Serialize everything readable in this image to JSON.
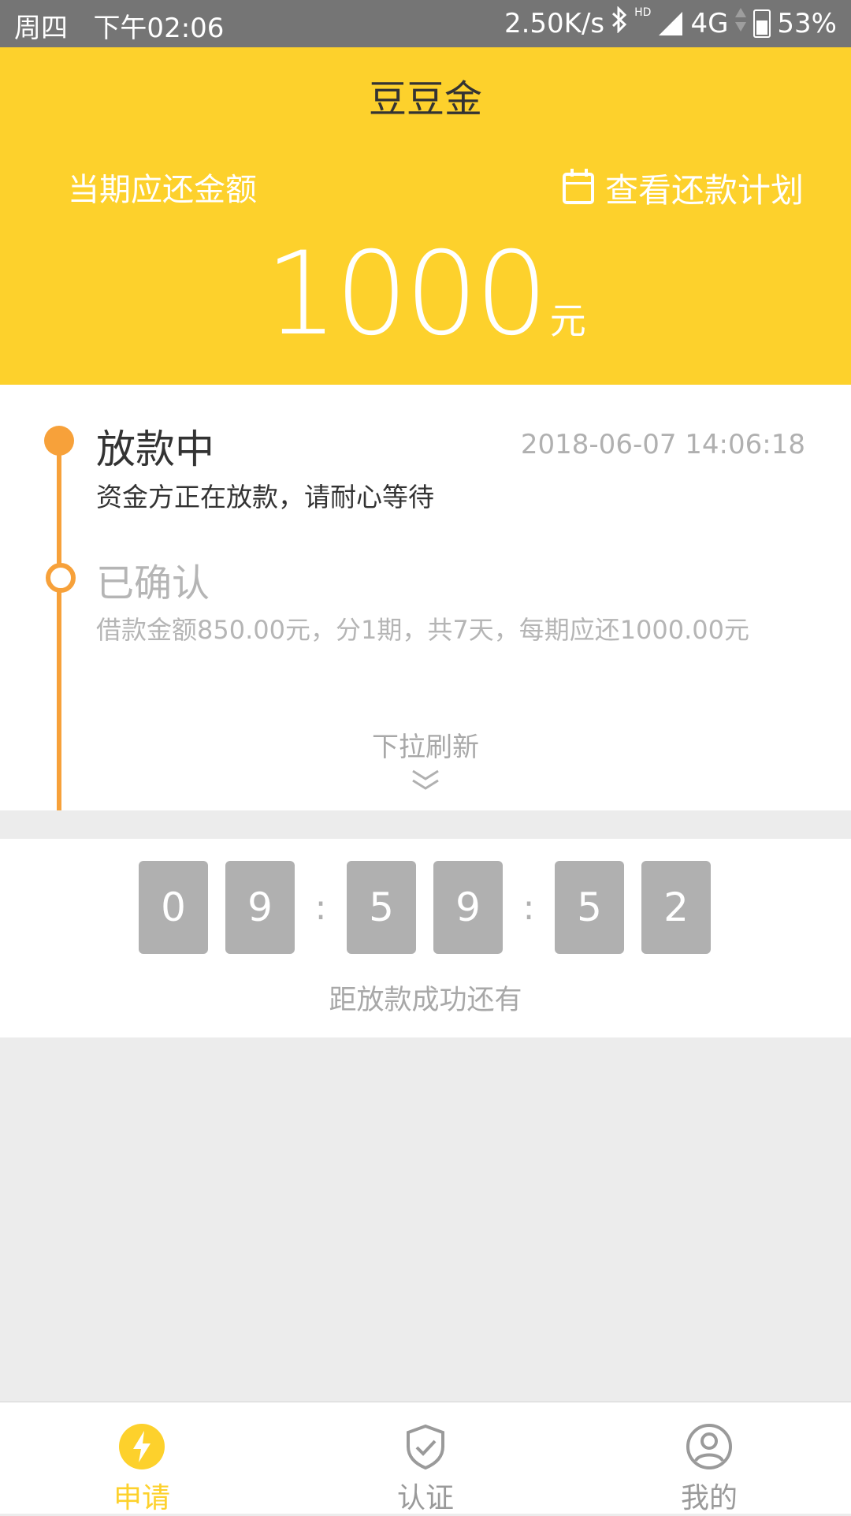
{
  "status_bar": {
    "day": "周四",
    "time": "下午02:06",
    "network_speed": "2.50K/s",
    "hd": "HD",
    "network_type": "4G",
    "battery": "53%"
  },
  "header": {
    "app_title": "豆豆金",
    "due_label": "当期应还金额",
    "plan_link_label": "查看还款计划",
    "amount": "1000",
    "amount_unit": "元",
    "background_color": "#fdd12c"
  },
  "timeline": {
    "accent_color": "#f7a13a",
    "events": [
      {
        "title": "放款中",
        "time": "2018-06-07 14:06:18",
        "description": "资金方正在放款，请耐心等待"
      },
      {
        "title": "已确认",
        "description": "借款金额850.00元，分1期，共7天，每期应还1000.00元"
      }
    ],
    "pull_refresh_label": "下拉刷新"
  },
  "countdown": {
    "digits": [
      "0",
      "9",
      "5",
      "9",
      "5",
      "2"
    ],
    "separator": ":",
    "label": "距放款成功还有"
  },
  "tab_bar": {
    "tabs": [
      {
        "label": "申请",
        "icon": "lightning-icon",
        "active": true
      },
      {
        "label": "认证",
        "icon": "shield-check-icon",
        "active": false
      },
      {
        "label": "我的",
        "icon": "user-icon",
        "active": false
      }
    ],
    "active_color": "#fdd12c",
    "inactive_color": "#9a9a9a"
  }
}
